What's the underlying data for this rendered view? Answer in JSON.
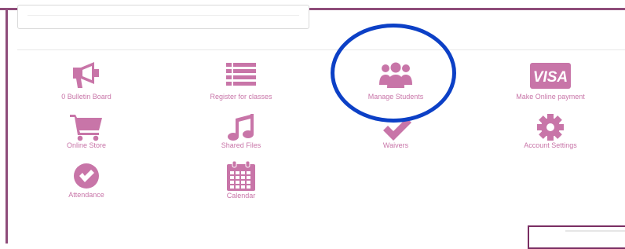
{
  "theme": {
    "accent": "#c875a8",
    "frame": "#8e4c7a",
    "annotation": "#0c40c6"
  },
  "menu": {
    "bulletin_board": {
      "label": "0 Bulletin Board",
      "icon": "megaphone-icon"
    },
    "register_classes": {
      "label": "Register for classes",
      "icon": "list-icon"
    },
    "manage_students": {
      "label": "Manage Students",
      "icon": "users-icon"
    },
    "online_payment": {
      "label": "Make Online payment",
      "icon": "visa-card-icon",
      "icon_text": "VISA"
    },
    "online_store": {
      "label": "Online Store",
      "icon": "shopping-cart-icon"
    },
    "shared_files": {
      "label": "Shared Files",
      "icon": "music-note-icon"
    },
    "waivers": {
      "label": "Waivers",
      "icon": "checkmark-icon"
    },
    "account_settings": {
      "label": "Account Settings",
      "icon": "gear-icon"
    },
    "attendance": {
      "label": "Attendance",
      "icon": "check-circle-icon"
    },
    "calendar": {
      "label": "Calendar",
      "icon": "calendar-icon"
    }
  }
}
